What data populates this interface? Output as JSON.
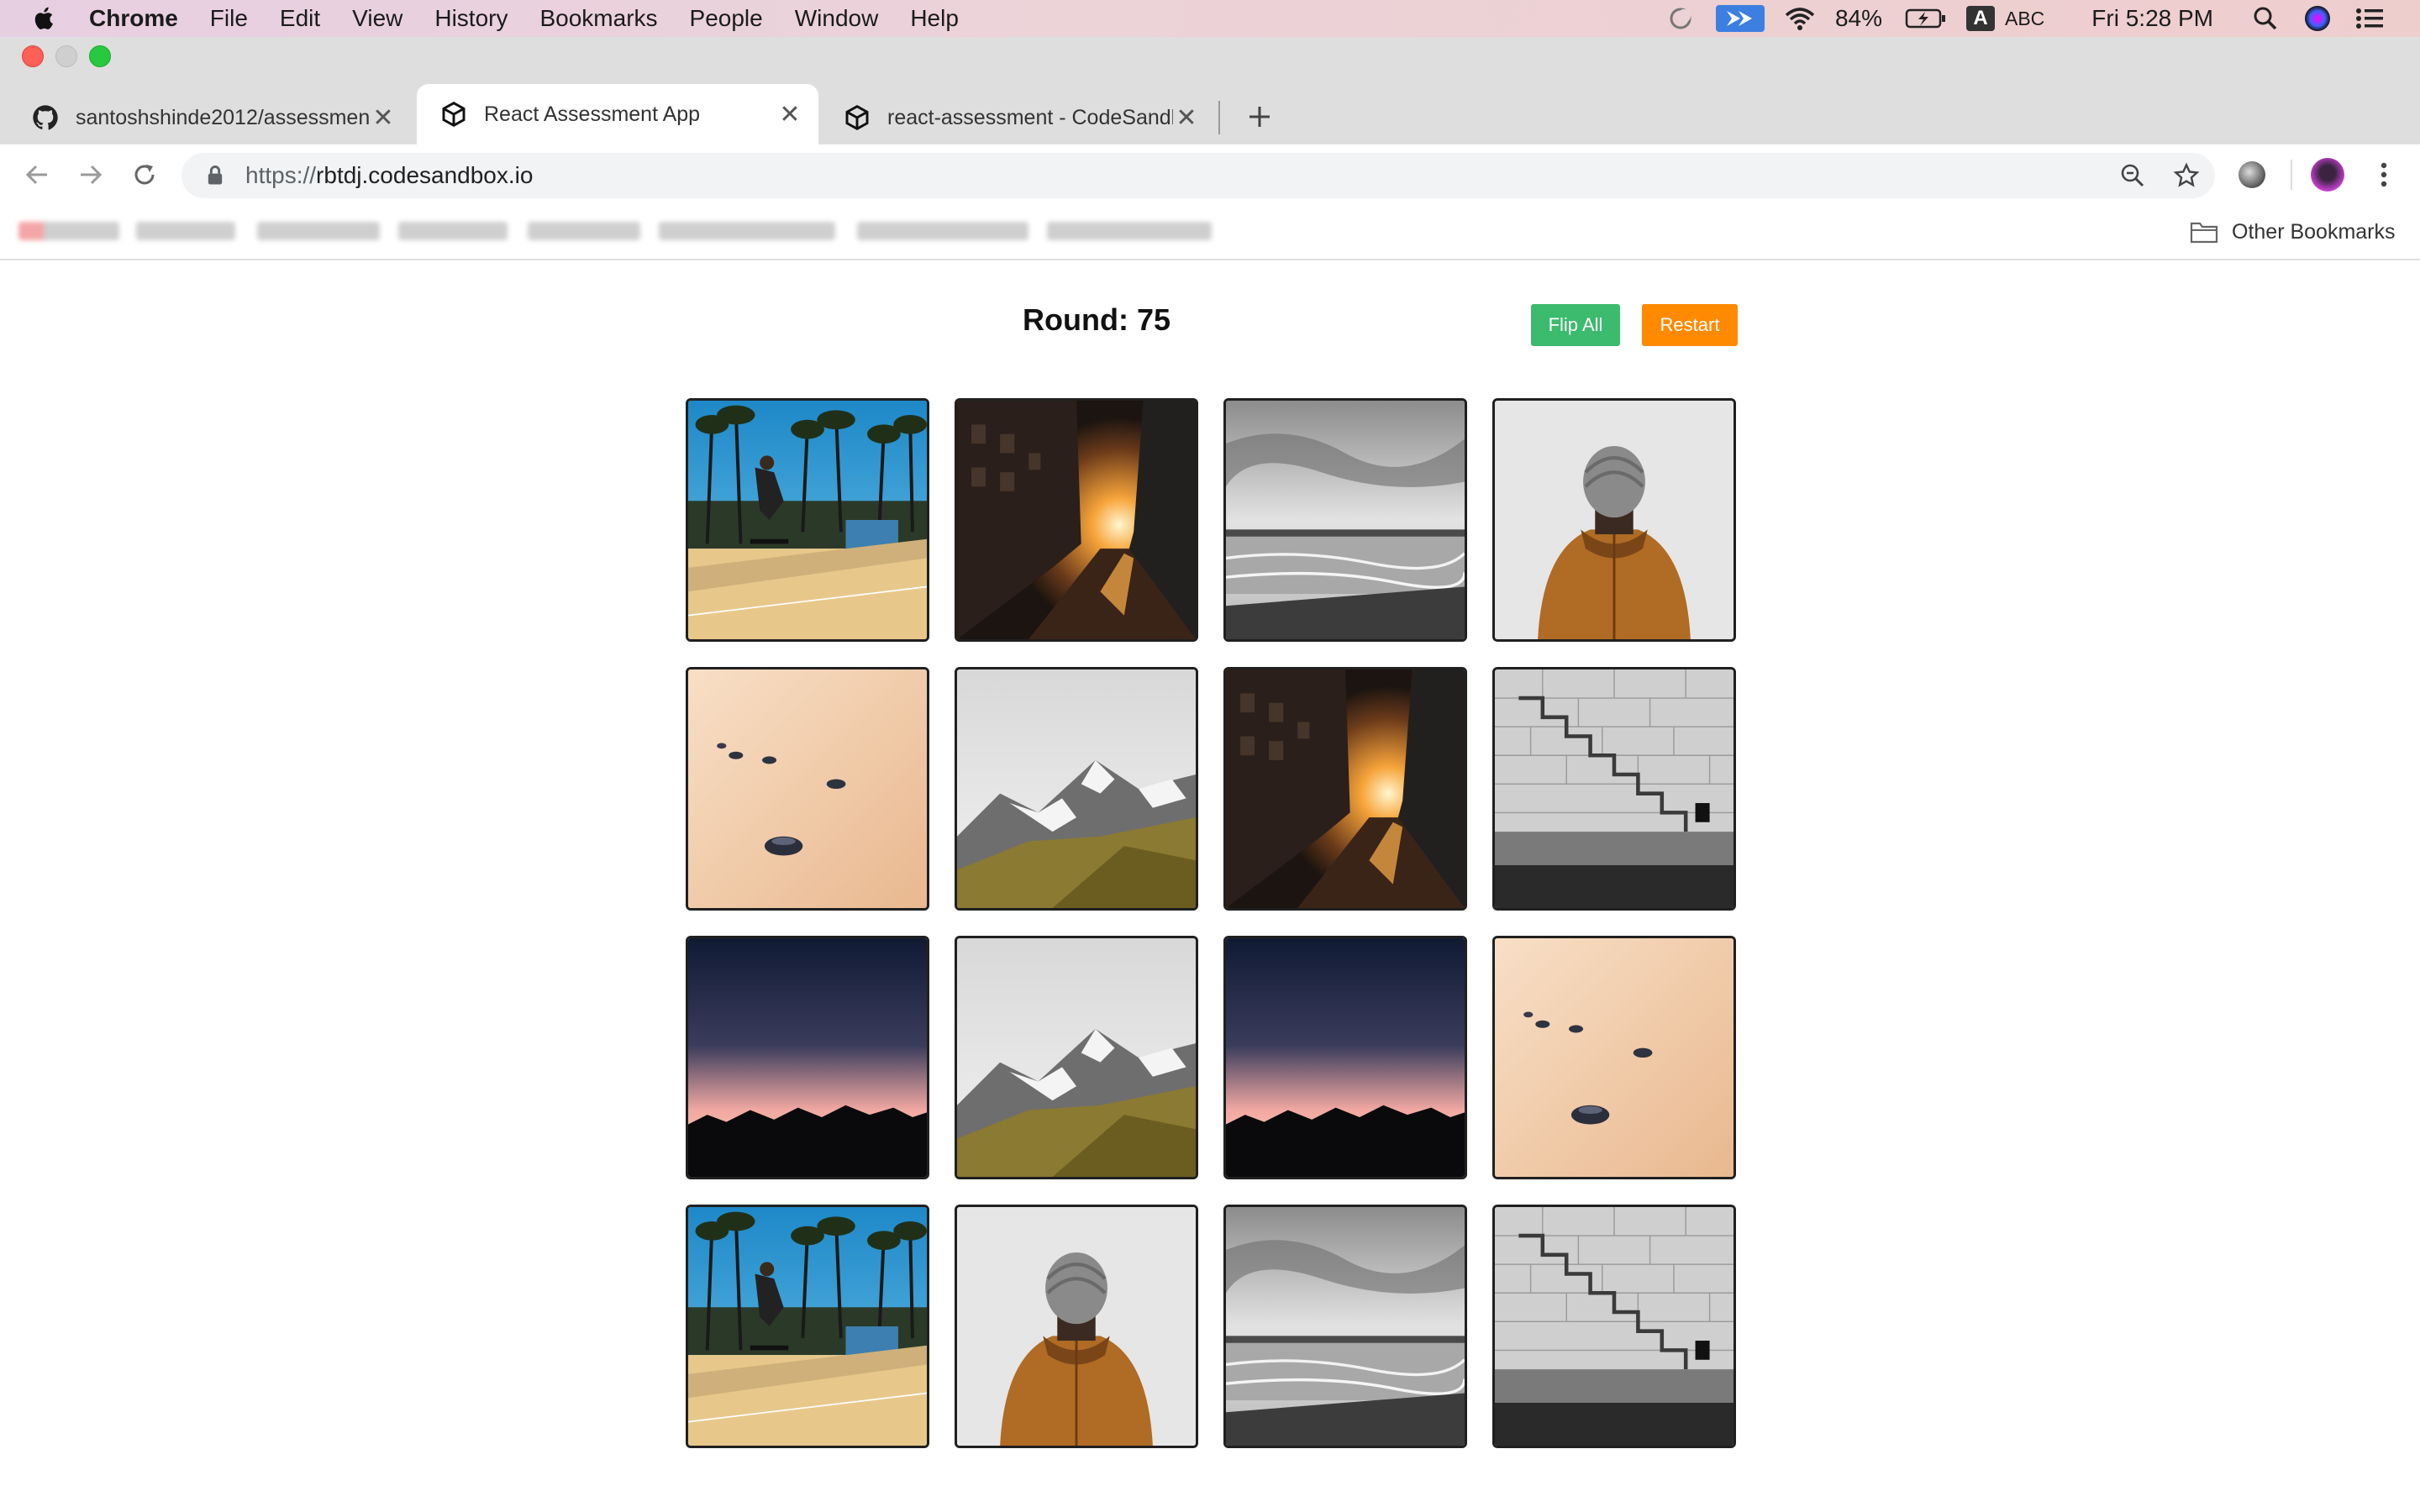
{
  "menubar": {
    "app_name": "Chrome",
    "items": [
      "File",
      "Edit",
      "View",
      "History",
      "Bookmarks",
      "People",
      "Window",
      "Help"
    ],
    "battery": "84%",
    "input_source": "ABC",
    "clock": "Fri 5:28 PM"
  },
  "tabs": [
    {
      "title": "santoshshinde2012/assessmen",
      "favicon": "github-icon",
      "active": false
    },
    {
      "title": "React Assessment App",
      "favicon": "codesandbox-icon",
      "active": true
    },
    {
      "title": "react-assessment - CodeSandb",
      "favicon": "codesandbox-icon",
      "active": false
    }
  ],
  "omnibox": {
    "scheme": "https://",
    "host": "rbtdj.codesandbox.io"
  },
  "bookmarks_bar": {
    "other_bookmarks": "Other Bookmarks"
  },
  "game": {
    "round_label": "Round: 75",
    "flip_all_label": "Flip All",
    "restart_label": "Restart",
    "accent_green": "#3cba6e",
    "accent_orange": "#ff8a00",
    "cards": [
      "skateboarder-palms",
      "sunset-street",
      "bw-beach",
      "hooded-person",
      "sand-pebbles",
      "snowy-mountain",
      "sunset-street",
      "bw-stairs-wall",
      "dusk-mountains",
      "snowy-mountain",
      "dusk-mountains",
      "sand-pebbles",
      "skateboarder-palms",
      "hooded-person",
      "bw-beach",
      "bw-stairs-wall"
    ]
  }
}
